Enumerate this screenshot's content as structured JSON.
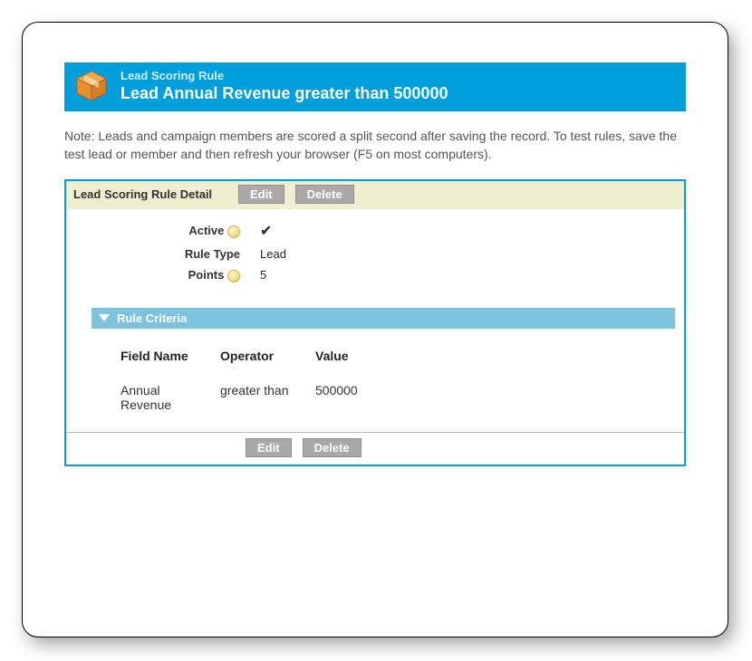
{
  "banner": {
    "kicker": "Lead Scoring Rule",
    "title": "Lead Annual Revenue greater than 500000"
  },
  "note": "Note: Leads and campaign members are scored a split second after saving the record. To test rules, save the test lead or member and then refresh your browser (F5 on most computers).",
  "detail": {
    "section_title": "Lead Scoring Rule Detail",
    "buttons": {
      "edit": "Edit",
      "delete": "Delete"
    },
    "fields": {
      "active": {
        "label": "Active",
        "value": "✔"
      },
      "rule_type": {
        "label": "Rule Type",
        "value": "Lead"
      },
      "points": {
        "label": "Points",
        "value": "5"
      }
    }
  },
  "criteria": {
    "heading": "Rule Criteria",
    "columns": {
      "field": "Field Name",
      "operator": "Operator",
      "value": "Value"
    },
    "rows": [
      {
        "field": "Annual Revenue",
        "operator": "greater than",
        "value": "500000"
      }
    ]
  },
  "footer_buttons": {
    "edit": "Edit",
    "delete": "Delete"
  }
}
